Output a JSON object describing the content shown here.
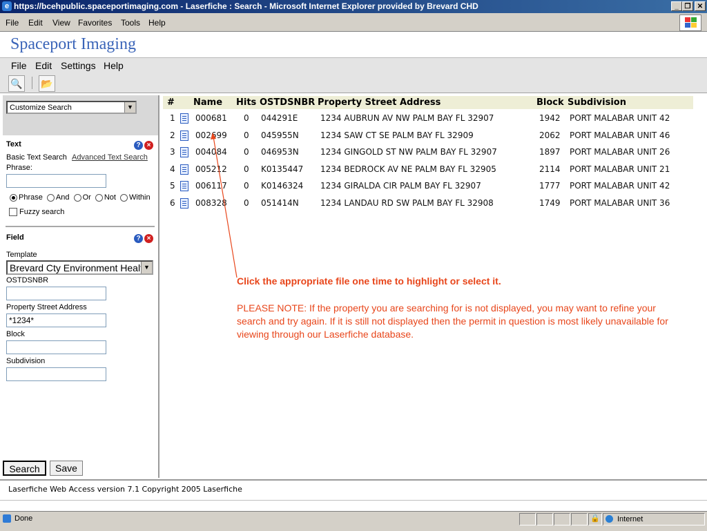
{
  "window": {
    "title": "https://bcehpublic.spaceportimaging.com - Laserfiche : Search - Microsoft Internet Explorer provided by Brevard CHD"
  },
  "browser_menu": [
    "File",
    "Edit",
    "View",
    "Favorites",
    "Tools",
    "Help"
  ],
  "brand": "Spaceport Imaging",
  "app_menu": [
    "File",
    "Edit",
    "Settings",
    "Help"
  ],
  "left": {
    "search_type": "Customize Search",
    "text_heading": "Text",
    "basic_text": "Basic Text Search",
    "advanced_link": "Advanced Text Search",
    "phrase_label": "Phrase:",
    "phrase_value": "",
    "radios": [
      "Phrase",
      "And",
      "Or",
      "Not",
      "Within"
    ],
    "fuzzy_label": "Fuzzy search",
    "field_heading": "Field",
    "template_label": "Template",
    "template_value": "Brevard Cty Environment Health",
    "ostdsnbr_label": "OSTDSNBR",
    "ostdsnbr_value": "",
    "address_label": "Property Street Address",
    "address_value": "*1234*",
    "block_label": "Block",
    "block_value": "",
    "subdivision_label": "Subdivision",
    "subdivision_value": "",
    "search_button": "Search",
    "save_button": "Save"
  },
  "table": {
    "headers": [
      "#",
      "Name",
      "Hits",
      "OSTDSNBR",
      "Property Street Address",
      "Block",
      "Subdivision"
    ],
    "rows": [
      [
        "1",
        "000681",
        "0",
        "044291E",
        "1234 AUBRUN AV NW PALM BAY FL 32907",
        "1942",
        "PORT MALABAR UNIT 42"
      ],
      [
        "2",
        "002699",
        "0",
        "045955N",
        "1234 SAW CT SE PALM BAY FL 32909",
        "2062",
        "PORT MALABAR UNIT 46"
      ],
      [
        "3",
        "004084",
        "0",
        "046953N",
        "1234 GINGOLD ST NW PALM BAY FL 32907",
        "1897",
        "PORT MALABAR UNIT 26"
      ],
      [
        "4",
        "005212",
        "0",
        "K0135447",
        "1234 BEDROCK AV NE PALM BAY FL 32905",
        "2114",
        "PORT MALABAR UNIT 21"
      ],
      [
        "5",
        "006117",
        "0",
        "K0146324",
        "1234 GIRALDA CIR PALM BAY FL 32907",
        "1777",
        "PORT MALABAR UNIT 42"
      ],
      [
        "6",
        "008328",
        "0",
        "051414N",
        "1234 LANDAU RD SW PALM BAY FL 32908",
        "1749",
        "PORT MALABAR UNIT 36"
      ]
    ]
  },
  "annotation": {
    "headline": "Click the appropriate file one time to highlight or select it.",
    "note": "PLEASE NOTE:  If the property you are searching for is not displayed, you may want to refine your search and try again.  If it is still not displayed then the permit in question is most likely unavailable for viewing through our Laserfiche database."
  },
  "footer": "Laserfiche Web Access version 7.1 Copyright 2005 Laserfiche",
  "status": {
    "left": "Done",
    "zone": "Internet"
  },
  "colors": {
    "accent": "#e8461b",
    "brand": "#3a64b8",
    "titlebar": "#0a246a"
  }
}
